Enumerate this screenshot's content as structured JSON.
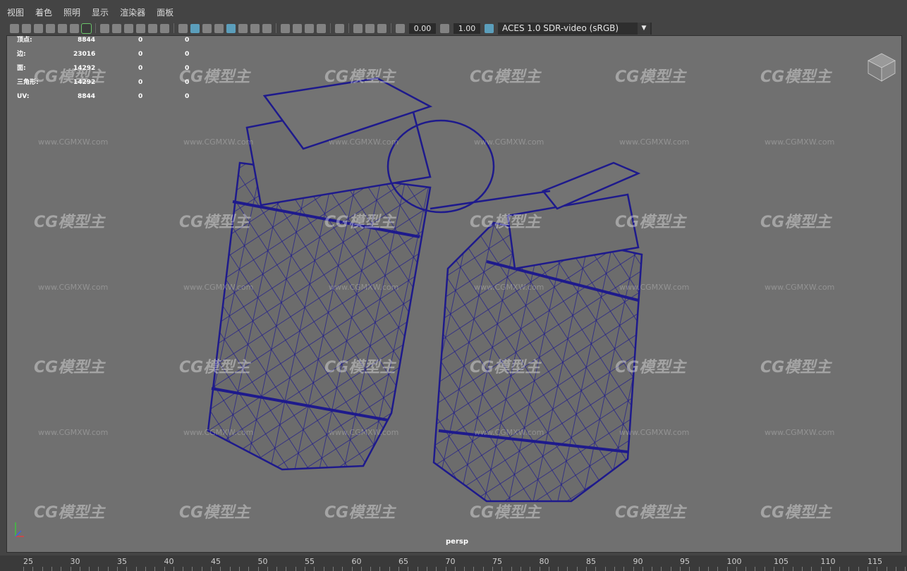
{
  "menu": [
    "视图",
    "着色",
    "照明",
    "显示",
    "渲染器",
    "面板"
  ],
  "toolbar": {
    "field1": "0.00",
    "field2": "1.00",
    "color_space": "ACES 1.0 SDR-video (sRGB)",
    "arrow": "▼"
  },
  "hud": [
    {
      "label": "顶点:",
      "v": "8844",
      "a": "0",
      "b": "0"
    },
    {
      "label": "边:",
      "v": "23016",
      "a": "0",
      "b": "0"
    },
    {
      "label": "面:",
      "v": "14292",
      "a": "0",
      "b": "0"
    },
    {
      "label": "三角形:",
      "v": "14292",
      "a": "0",
      "b": "0"
    },
    {
      "label": "UV:",
      "v": "8844",
      "a": "0",
      "b": "0"
    }
  ],
  "watermark": {
    "logo": "CG模型主",
    "url": "www.CGMXW.com"
  },
  "camera_label": "persp",
  "ruler": [
    "25",
    "30",
    "35",
    "40",
    "45",
    "50",
    "55",
    "60",
    "65",
    "70",
    "75",
    "80",
    "85",
    "90",
    "95",
    "100",
    "105",
    "110",
    "115"
  ],
  "colors": {
    "wire": "#1e1a8c",
    "viewport_bg": "#707070",
    "mesh_fill": "#6d6d6d"
  }
}
